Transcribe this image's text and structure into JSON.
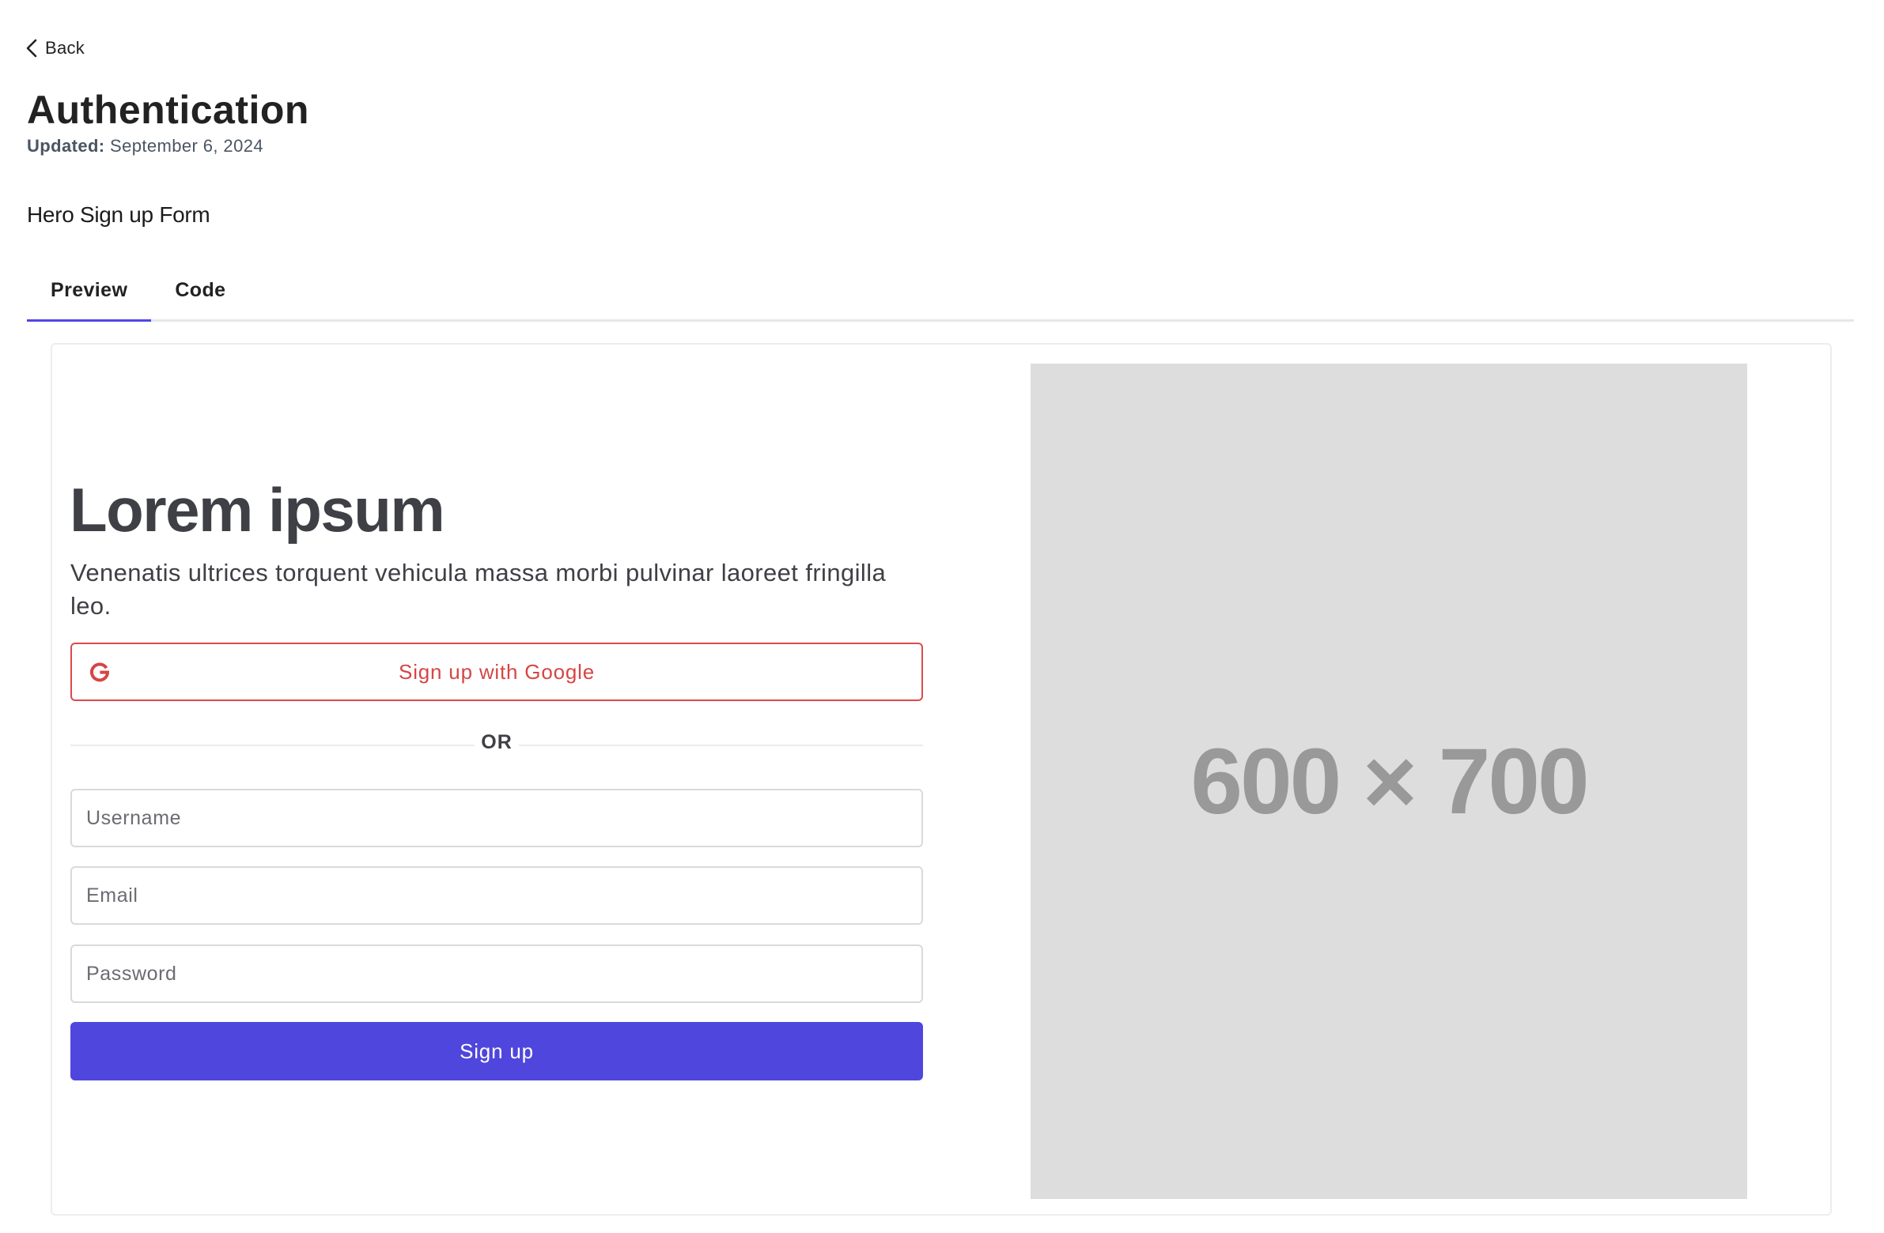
{
  "nav": {
    "back_label": "Back"
  },
  "page": {
    "title": "Authentication",
    "updated_label": "Updated:",
    "updated_date": "September 6, 2024",
    "section_title": "Hero Sign up Form"
  },
  "tabs": [
    {
      "label": "Preview",
      "active": true
    },
    {
      "label": "Code",
      "active": false
    }
  ],
  "hero": {
    "heading": "Lorem ipsum",
    "description": "Venenatis ultrices torquent vehicula massa morbi pulvinar laoreet fringilla leo.",
    "google_button_label": "Sign up with Google",
    "divider_text": "OR",
    "username_placeholder": "Username",
    "email_placeholder": "Email",
    "password_placeholder": "Password",
    "signup_button_label": "Sign up"
  },
  "image_placeholder": {
    "text": "600 × 700"
  },
  "colors": {
    "accent": "#4f46dd",
    "google_red": "#dc4a4a",
    "placeholder_bg": "#dddddd",
    "placeholder_text": "#999999"
  },
  "icons": {
    "back": "chevron-left-icon",
    "google": "google-g-icon"
  }
}
